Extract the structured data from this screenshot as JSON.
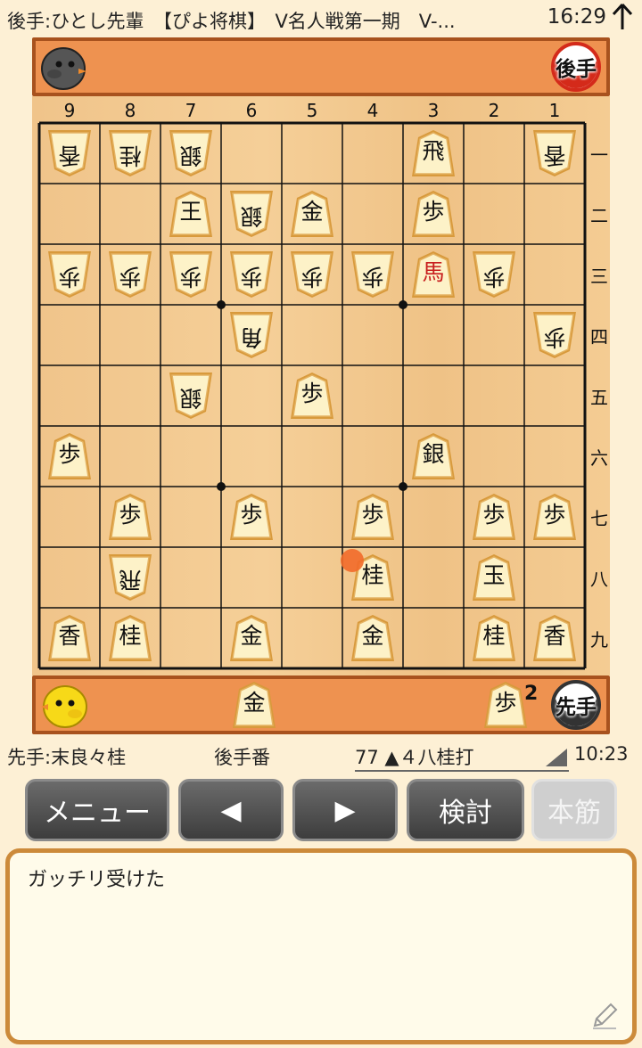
{
  "status_bar": {
    "title": "後手:ひとし先輩　【ぴよ将棋】　V名人戦第一期　V-...",
    "time": "16:29",
    "icon": "arrow-up-icon"
  },
  "gote": {
    "label": "後手",
    "avatar": "gray-bird-icon",
    "hand": []
  },
  "sente": {
    "label": "先手",
    "avatar": "yellow-chick-icon",
    "hand": [
      {
        "piece": "金",
        "count": ""
      },
      {
        "piece": "歩",
        "count": "2"
      }
    ]
  },
  "board": {
    "files": [
      "9",
      "8",
      "7",
      "6",
      "5",
      "4",
      "3",
      "2",
      "1"
    ],
    "ranks": [
      "一",
      "二",
      "三",
      "四",
      "五",
      "六",
      "七",
      "八",
      "九"
    ],
    "pieces": [
      {
        "file": 9,
        "rank": 1,
        "glyph": "香",
        "owner": "gote"
      },
      {
        "file": 8,
        "rank": 1,
        "glyph": "桂",
        "owner": "gote"
      },
      {
        "file": 7,
        "rank": 1,
        "glyph": "銀",
        "owner": "gote"
      },
      {
        "file": 3,
        "rank": 1,
        "glyph": "飛",
        "owner": "sente"
      },
      {
        "file": 1,
        "rank": 1,
        "glyph": "香",
        "owner": "gote"
      },
      {
        "file": 7,
        "rank": 2,
        "glyph": "王",
        "owner": "sente"
      },
      {
        "file": 6,
        "rank": 2,
        "glyph": "銀",
        "owner": "gote"
      },
      {
        "file": 5,
        "rank": 2,
        "glyph": "金",
        "owner": "sente"
      },
      {
        "file": 3,
        "rank": 2,
        "glyph": "歩",
        "owner": "sente"
      },
      {
        "file": 9,
        "rank": 3,
        "glyph": "歩",
        "owner": "gote"
      },
      {
        "file": 8,
        "rank": 3,
        "glyph": "歩",
        "owner": "gote"
      },
      {
        "file": 7,
        "rank": 3,
        "glyph": "歩",
        "owner": "gote"
      },
      {
        "file": 6,
        "rank": 3,
        "glyph": "歩",
        "owner": "gote"
      },
      {
        "file": 5,
        "rank": 3,
        "glyph": "歩",
        "owner": "gote"
      },
      {
        "file": 4,
        "rank": 3,
        "glyph": "歩",
        "owner": "gote"
      },
      {
        "file": 3,
        "rank": 3,
        "glyph": "馬",
        "owner": "sente",
        "promoted": true
      },
      {
        "file": 2,
        "rank": 3,
        "glyph": "歩",
        "owner": "gote"
      },
      {
        "file": 6,
        "rank": 4,
        "glyph": "角",
        "owner": "gote"
      },
      {
        "file": 1,
        "rank": 4,
        "glyph": "歩",
        "owner": "gote"
      },
      {
        "file": 7,
        "rank": 5,
        "glyph": "銀",
        "owner": "gote"
      },
      {
        "file": 5,
        "rank": 5,
        "glyph": "歩",
        "owner": "sente"
      },
      {
        "file": 9,
        "rank": 6,
        "glyph": "歩",
        "owner": "sente"
      },
      {
        "file": 3,
        "rank": 6,
        "glyph": "銀",
        "owner": "sente"
      },
      {
        "file": 8,
        "rank": 7,
        "glyph": "歩",
        "owner": "sente"
      },
      {
        "file": 6,
        "rank": 7,
        "glyph": "歩",
        "owner": "sente"
      },
      {
        "file": 4,
        "rank": 7,
        "glyph": "歩",
        "owner": "sente"
      },
      {
        "file": 2,
        "rank": 7,
        "glyph": "歩",
        "owner": "sente"
      },
      {
        "file": 1,
        "rank": 7,
        "glyph": "歩",
        "owner": "sente"
      },
      {
        "file": 8,
        "rank": 8,
        "glyph": "飛",
        "owner": "gote"
      },
      {
        "file": 4,
        "rank": 8,
        "glyph": "桂",
        "owner": "sente"
      },
      {
        "file": 2,
        "rank": 8,
        "glyph": "玉",
        "owner": "sente"
      },
      {
        "file": 9,
        "rank": 9,
        "glyph": "香",
        "owner": "sente"
      },
      {
        "file": 8,
        "rank": 9,
        "glyph": "桂",
        "owner": "sente"
      },
      {
        "file": 6,
        "rank": 9,
        "glyph": "金",
        "owner": "sente"
      },
      {
        "file": 4,
        "rank": 9,
        "glyph": "金",
        "owner": "sente"
      },
      {
        "file": 2,
        "rank": 9,
        "glyph": "桂",
        "owner": "sente"
      },
      {
        "file": 1,
        "rank": 9,
        "glyph": "香",
        "owner": "sente"
      }
    ],
    "last_move_marker": {
      "file": 4,
      "rank": 8
    }
  },
  "info": {
    "sente_player": "先手:末良々桂",
    "turn": "後手番",
    "last_move": "77 ▲４八桂打",
    "clock": "10:23"
  },
  "buttons": {
    "menu": "メニュー",
    "prev": "◀",
    "next": "▶",
    "analyze": "検討",
    "mainline": "本筋"
  },
  "comment": {
    "text": "ガッチリ受けた",
    "edit_icon": "pencil-icon"
  },
  "colors": {
    "bar": "#ee9250",
    "bar_border": "#a8521e",
    "promoted": "#c81e1e",
    "button": "#4a4a4a",
    "comment_border": "#cc8a3a"
  }
}
